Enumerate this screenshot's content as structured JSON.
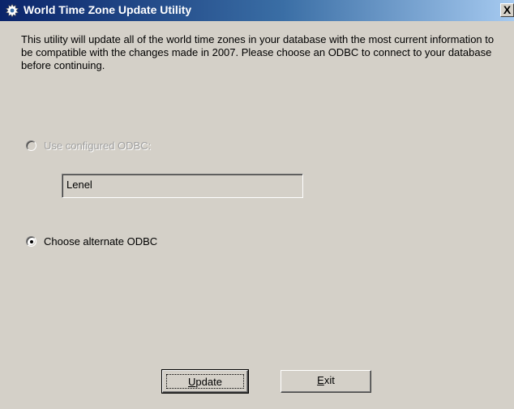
{
  "window": {
    "title": "World Time Zone Update Utility",
    "close_label": "X"
  },
  "description": "This utility will update all of the world time zones in your database with the most current information to be compatible with the changes made in 2007. Please choose an ODBC to connect to your database before continuing.",
  "options": {
    "configured": {
      "label": "Use configured ODBC:",
      "selected": false,
      "enabled": false,
      "value": "Lenel"
    },
    "alternate": {
      "label": "Choose alternate ODBC",
      "selected": true,
      "enabled": true
    }
  },
  "buttons": {
    "update": {
      "mnemonic": "U",
      "rest": "pdate"
    },
    "exit": {
      "mnemonic": "E",
      "rest": "xit"
    }
  },
  "icons": {
    "app": "gear-icon",
    "close": "close-icon"
  }
}
